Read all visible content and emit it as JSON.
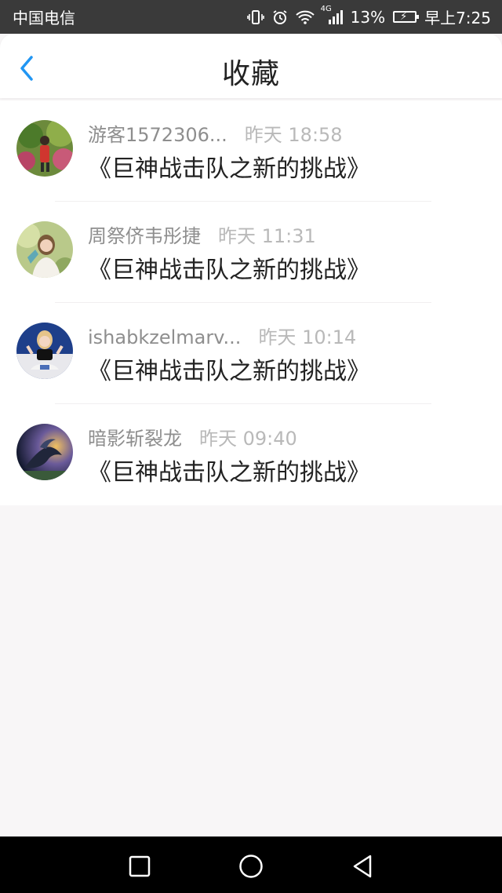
{
  "status_bar": {
    "carrier": "中国电信",
    "network": "4G",
    "battery_percent": "13%",
    "time": "早上7:25"
  },
  "header": {
    "title": "收藏",
    "back_icon": "chevron-left-icon",
    "accent_color": "#2196f3"
  },
  "favorites": [
    {
      "user": "游客1572306...",
      "time": "昨天 18:58",
      "title": "《巨神战击队之新的挑战》"
    },
    {
      "user": "周祭侪韦彤捷",
      "time": "昨天 11:31",
      "title": "《巨神战击队之新的挑战》"
    },
    {
      "user": "ishabkzelmarv...",
      "time": "昨天 10:14",
      "title": "《巨神战击队之新的挑战》"
    },
    {
      "user": "暗影斩裂龙",
      "time": "昨天 09:40",
      "title": "《巨神战击队之新的挑战》"
    }
  ],
  "nav_bar": {
    "recent_icon": "square-icon",
    "home_icon": "circle-icon",
    "back_icon": "triangle-back-icon"
  }
}
